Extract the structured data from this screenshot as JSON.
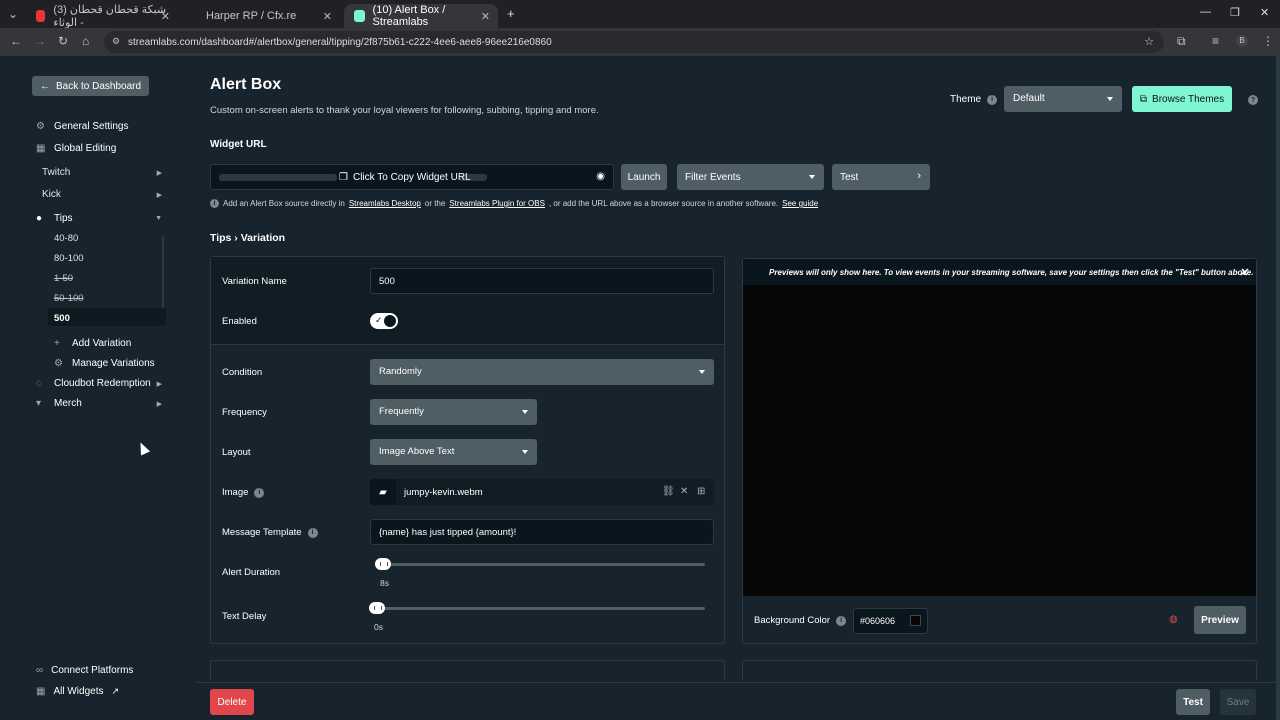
{
  "browser": {
    "tabs": [
      {
        "label": "(3) شبكة قحطان قحطان الوثاء -",
        "color": "#e53935"
      },
      {
        "label": "Harper RP / Cfx.re",
        "color": "#888888"
      },
      {
        "label": "(10) Alert Box / Streamlabs",
        "color": "#80f5d2"
      }
    ],
    "new_tab": "+",
    "url": "streamlabs.com/dashboard#/alertbox/general/tipping/2f875b61-c222-4ee6-aee8-96ee216e0860",
    "profile_initial": "B"
  },
  "sidebar": {
    "back_label": "Back to Dashboard",
    "general_settings": "General Settings",
    "global_editing": "Global Editing",
    "twitch": "Twitch",
    "kick": "Kick",
    "tips": "Tips",
    "variations": [
      "40-80",
      "80-100",
      "1-50",
      "50-100",
      "500"
    ],
    "add_variation": "Add Variation",
    "manage_variations": "Manage Variations",
    "cloudbot": "Cloudbot Redemption",
    "merch": "Merch",
    "connect_platforms": "Connect Platforms",
    "all_widgets": "All Widgets"
  },
  "header": {
    "title": "Alert Box",
    "subtitle": "Custom on-screen alerts to thank your loyal viewers for following, subbing, tipping and more.",
    "theme_label": "Theme",
    "theme_value": "Default",
    "browse_themes": "Browse Themes"
  },
  "widget": {
    "label": "Widget URL",
    "copy_label": "Click To Copy Widget URL",
    "launch": "Launch",
    "filter_events": "Filter Events",
    "test": "Test",
    "hint_pre": "Add an Alert Box source directly in",
    "hint_link1": "Streamlabs Desktop",
    "hint_mid": "or the",
    "hint_link2": "Streamlabs Plugin for OBS",
    "hint_post": ", or add the URL above as a browser source in another software.",
    "hint_link3": "See guide"
  },
  "breadcrumb": "Tips › Variation",
  "form": {
    "variation_name_label": "Variation Name",
    "variation_name_value": "500",
    "enabled_label": "Enabled",
    "condition_label": "Condition",
    "condition_value": "Randomly",
    "frequency_label": "Frequency",
    "frequency_value": "Frequently",
    "layout_label": "Layout",
    "layout_value": "Image Above Text",
    "image_label": "Image",
    "image_file": "jumpy-kevin.webm",
    "message_label": "Message Template",
    "message_value": "{name} has just tipped {amount}!",
    "duration_label": "Alert Duration",
    "duration_value": "8s",
    "text_delay_label": "Text Delay",
    "text_delay_value": "0s"
  },
  "preview": {
    "note": "Previews will only show here. To view events in your streaming software, save your settings then click the \"Test\" button above.",
    "bg_label": "Background Color",
    "bg_value": "#060606",
    "preview_btn": "Preview"
  },
  "footer": {
    "delete": "Delete",
    "test": "Test",
    "save": "Save"
  }
}
